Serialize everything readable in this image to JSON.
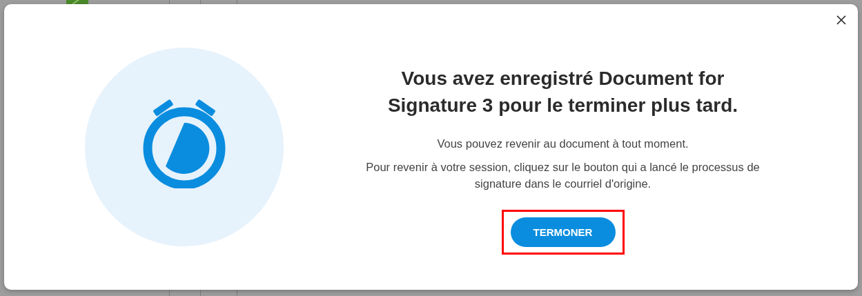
{
  "dialog": {
    "title": "Vous avez enregistré Document for Signature 3 pour le terminer plus tard.",
    "paragraphs": [
      "Vous pouvez revenir au document à tout moment.",
      "Pour revenir à votre session, cliquez sur le bouton qui a lancé le processus de signature dans le courriel d'origine."
    ],
    "button": {
      "label": "TERMONER",
      "highlighted": true
    }
  }
}
